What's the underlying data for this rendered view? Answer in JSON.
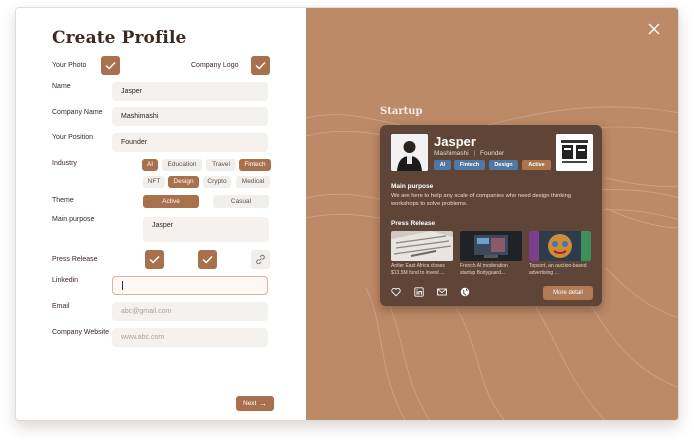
{
  "form": {
    "title": "Create Profile",
    "your_photo_label": "Your Photo",
    "company_logo_label": "Company Logo",
    "name_label": "Name",
    "name_value": "Jasper",
    "company_name_label": "Company Name",
    "company_name_value": "Mashimashi",
    "position_label": "Your Position",
    "position_value": "Founder",
    "industry_label": "Industry",
    "industries": [
      {
        "label": "AI",
        "selected": true
      },
      {
        "label": "Education",
        "selected": false
      },
      {
        "label": "Travel",
        "selected": false
      },
      {
        "label": "Fintech",
        "selected": true
      },
      {
        "label": "NFT",
        "selected": false
      },
      {
        "label": "Design",
        "selected": true
      },
      {
        "label": "Crypto",
        "selected": false
      },
      {
        "label": "Medical",
        "selected": false
      }
    ],
    "theme_label": "Theme",
    "theme_options": [
      {
        "label": "Active",
        "selected": true
      },
      {
        "label": "Casual",
        "selected": false
      }
    ],
    "main_purpose_label": "Main purpose",
    "main_purpose_value": "Jasper",
    "press_release_label": "Press Release",
    "linkedin_label": "Linkedin",
    "linkedin_value": "",
    "email_label": "Email",
    "email_placeholder": "abc@gmail.com",
    "website_label": "Company Website",
    "website_placeholder": "www.abc.com",
    "next_label": "Next",
    "next_arrow": "→"
  },
  "preview": {
    "heading": "Startup",
    "name": "Jasper",
    "company": "Mashimashi",
    "separator": "|",
    "role": "Founder",
    "tags": [
      {
        "label": "AI",
        "color": "#4f79a4"
      },
      {
        "label": "Fintech",
        "color": "#4f79a4"
      },
      {
        "label": "Design",
        "color": "#4f79a4"
      },
      {
        "label": "Active",
        "color": "#b0744b"
      }
    ],
    "main_purpose_title": "Main purpose",
    "main_purpose_text": "We are here to help any scale of companies who need design thinking workshops to solve problems.",
    "press_release_title": "Press Release",
    "press": [
      {
        "caption": "Antler East Africa closes $13.5M fund to invest ..."
      },
      {
        "caption": "French AI moderation startup Bodyguard..."
      },
      {
        "caption": "Topsort, an auction-based advertising ..."
      }
    ],
    "social_icons": [
      "heart-icon",
      "linkedin-icon",
      "mail-icon",
      "globe-icon"
    ],
    "more_label": "More detail"
  },
  "colors": {
    "accent": "#a8704d",
    "panel_bg": "#bd8a67",
    "card_bg": "#5f4538",
    "tag_blue": "#4f79a4"
  }
}
